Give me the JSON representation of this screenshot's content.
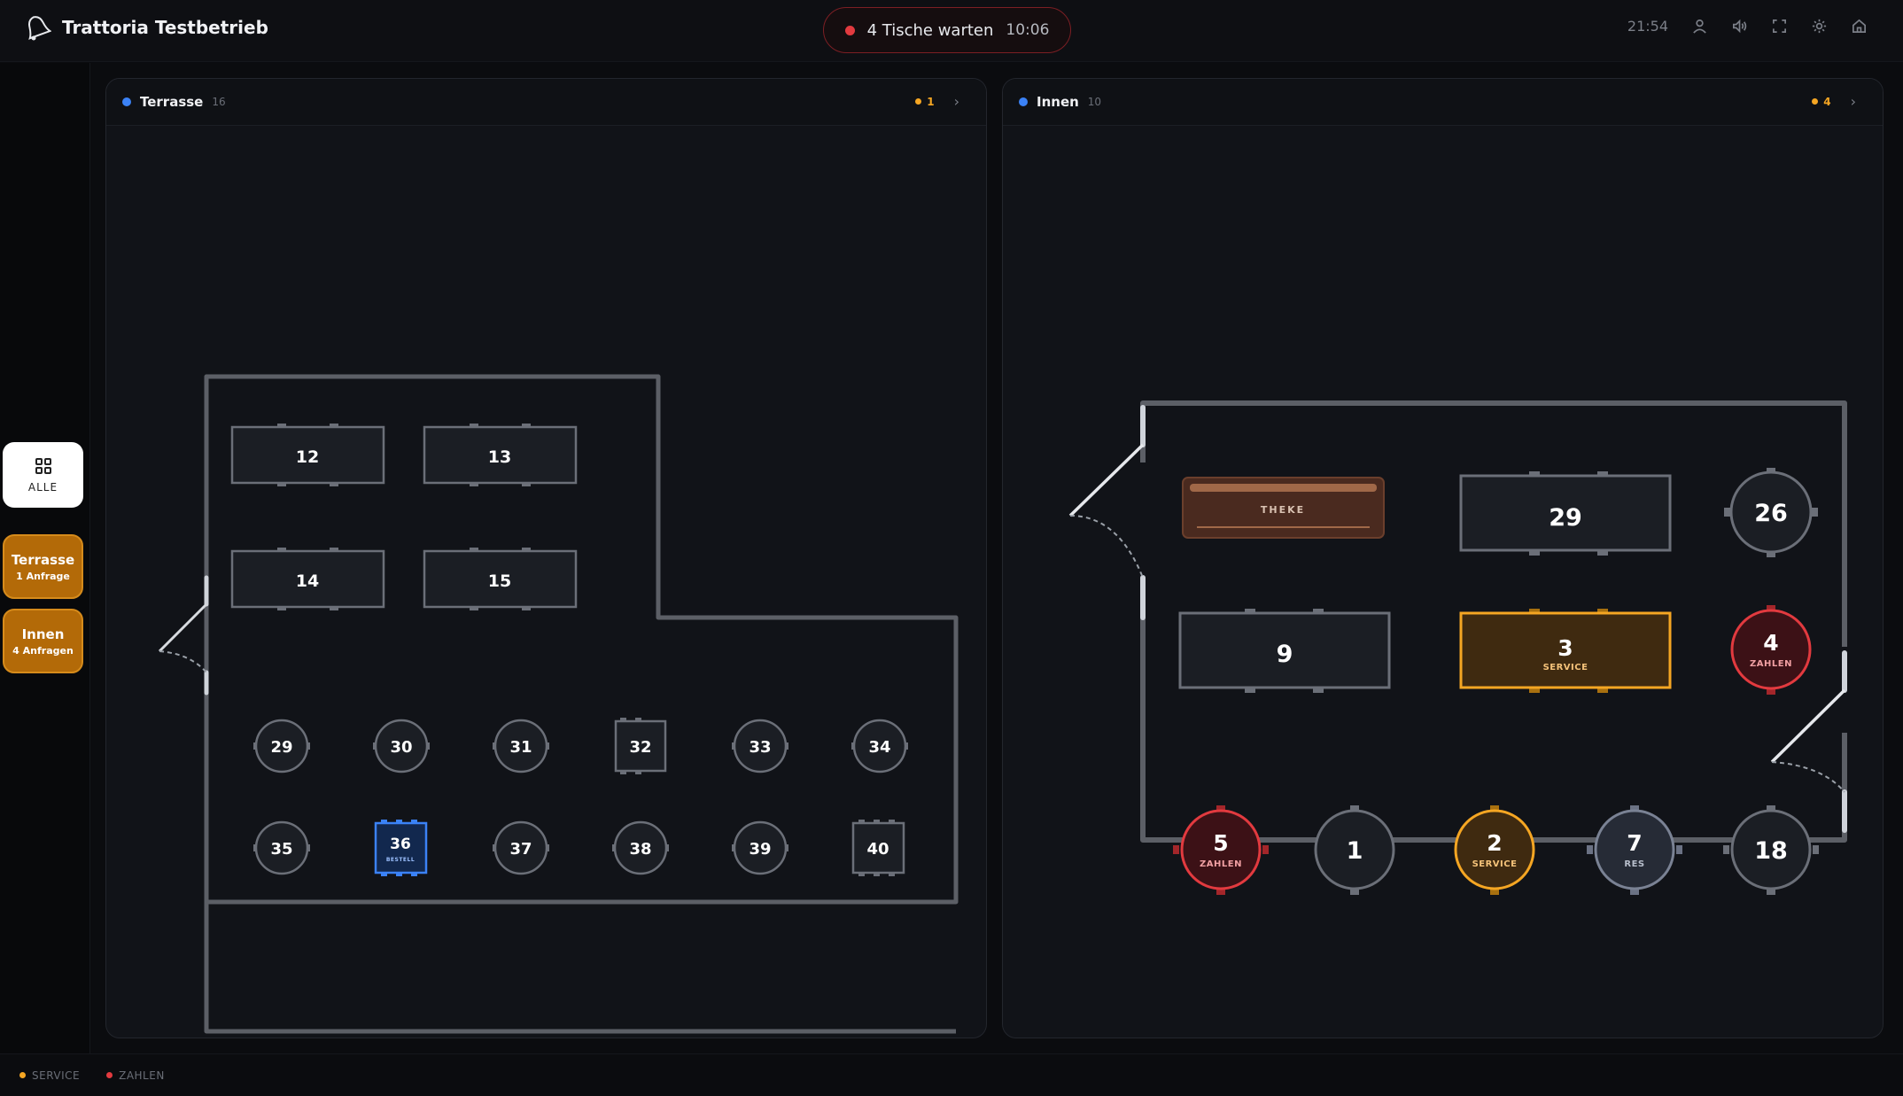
{
  "header": {
    "title": "Trattoria Testbetrieb",
    "waiting_text": "4 Tische warten",
    "waiting_time": "10:06",
    "clock": "21:54"
  },
  "colors": {
    "service": "#f5a623",
    "zahlen": "#e23a3f",
    "bestell": "#3b82f6",
    "zone_dot": "#3b82f6",
    "zone_button": "#b36a08"
  },
  "rail": {
    "all_label": "ALLE",
    "zones": [
      {
        "name": "Terrasse",
        "requests": "1 Anfrage"
      },
      {
        "name": "Innen",
        "requests": "4 Anfragen"
      }
    ]
  },
  "panels": {
    "terrasse": {
      "name": "Terrasse",
      "count": "16",
      "badge": "1",
      "tables": [
        {
          "n": "12"
        },
        {
          "n": "13"
        },
        {
          "n": "14"
        },
        {
          "n": "15"
        },
        {
          "n": "29"
        },
        {
          "n": "30"
        },
        {
          "n": "31"
        },
        {
          "n": "32"
        },
        {
          "n": "33"
        },
        {
          "n": "34"
        },
        {
          "n": "35"
        },
        {
          "n": "36",
          "status": "BESTELL"
        },
        {
          "n": "37"
        },
        {
          "n": "38"
        },
        {
          "n": "39"
        },
        {
          "n": "40"
        }
      ]
    },
    "innen": {
      "name": "Innen",
      "count": "10",
      "badge": "4",
      "counter_label": "THEKE",
      "tables": [
        {
          "n": "29"
        },
        {
          "n": "26"
        },
        {
          "n": "9"
        },
        {
          "n": "3",
          "status": "SERVICE"
        },
        {
          "n": "4",
          "status": "ZAHLEN"
        },
        {
          "n": "5",
          "status": "ZAHLEN"
        },
        {
          "n": "1"
        },
        {
          "n": "2",
          "status": "SERVICE"
        },
        {
          "n": "7",
          "status": "RES"
        },
        {
          "n": "18"
        }
      ]
    }
  },
  "footer": {
    "legend": [
      {
        "label": "SERVICE",
        "color": "#f5a623"
      },
      {
        "label": "ZAHLEN",
        "color": "#e23a3f"
      }
    ]
  }
}
